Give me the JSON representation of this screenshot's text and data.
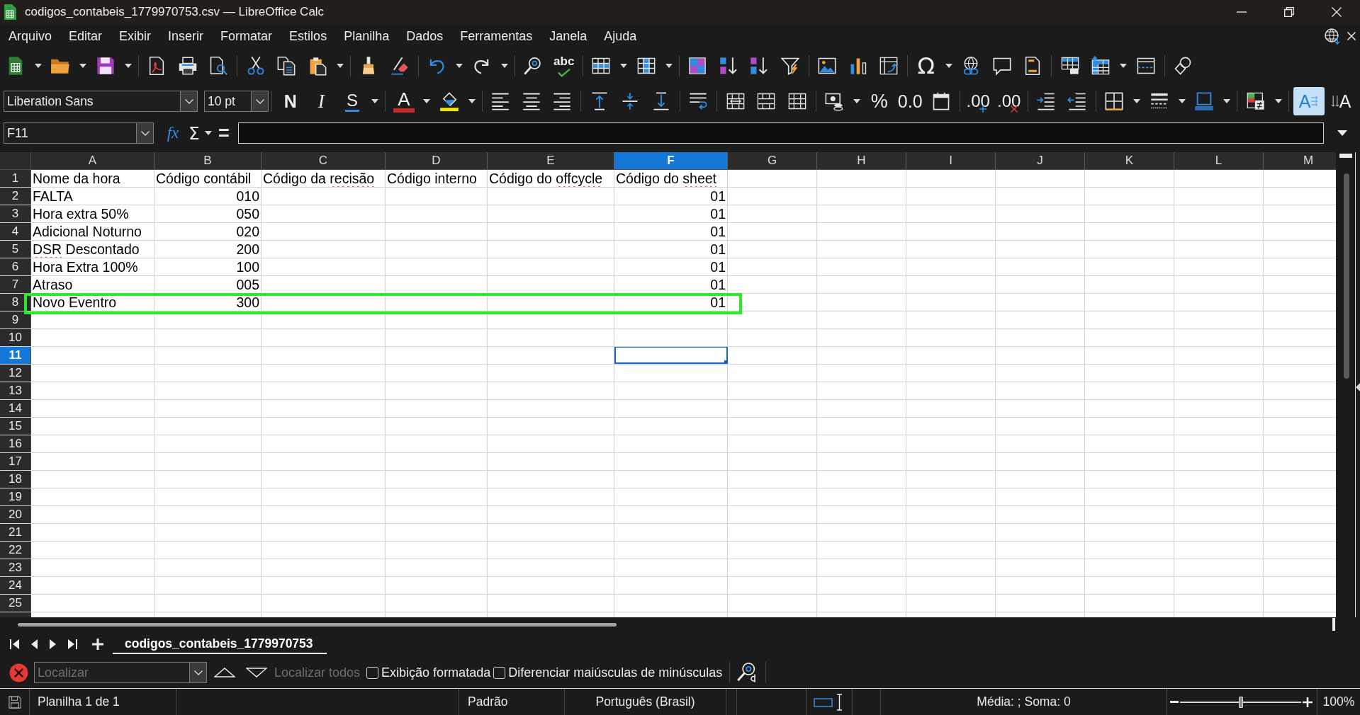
{
  "window": {
    "title": "codigos_contabeis_1779970753.csv — LibreOffice Calc"
  },
  "menu": [
    "Arquivo",
    "Editar",
    "Exibir",
    "Inserir",
    "Formatar",
    "Estilos",
    "Planilha",
    "Dados",
    "Ferramentas",
    "Janela",
    "Ajuda"
  ],
  "standard_toolbar": {
    "spelling": "abc",
    "special_character": "Ω"
  },
  "format_toolbar": {
    "font_name": "Liberation Sans",
    "font_size": "10 pt",
    "bold": "N",
    "italic": "I",
    "underline": "S",
    "font_color": "A",
    "percent": "%",
    "number_format": "0.0",
    "add_decimal": ".00",
    "delete_decimal": ".00",
    "text_direction": [
      {
        "kind": "horizontal",
        "glyph": "A",
        "selected": true
      },
      {
        "kind": "vertical",
        "glyph": "A",
        "selected": false
      }
    ]
  },
  "formula_bar": {
    "cell_reference": "F11",
    "function_wizard": "fx",
    "sum": "Σ",
    "formula": "="
  },
  "sheet": {
    "columns": [
      {
        "label": "A",
        "selected": false
      },
      {
        "label": "B",
        "selected": false
      },
      {
        "label": "C",
        "selected": false
      },
      {
        "label": "D",
        "selected": false
      },
      {
        "label": "E",
        "selected": false
      },
      {
        "label": "F",
        "selected": true
      },
      {
        "label": "G",
        "selected": false
      },
      {
        "label": "H",
        "selected": false
      },
      {
        "label": "I",
        "selected": false
      },
      {
        "label": "J",
        "selected": false
      },
      {
        "label": "K",
        "selected": false
      },
      {
        "label": "L",
        "selected": false
      },
      {
        "label": "M",
        "selected": false
      }
    ],
    "rows": [
      {
        "number": "1",
        "selected": false,
        "highlighted": false,
        "cells": [
          {
            "kind": "text",
            "parts": [
              {
                "text": "Nome da hora",
                "misspelled": false
              }
            ]
          },
          {
            "kind": "text",
            "parts": [
              {
                "text": "Código contábil",
                "misspelled": false
              }
            ]
          },
          {
            "kind": "text",
            "parts": [
              {
                "text": "Código da ",
                "misspelled": false
              },
              {
                "text": "recisão",
                "misspelled": true
              }
            ]
          },
          {
            "kind": "text",
            "parts": [
              {
                "text": "Código interno",
                "misspelled": false
              }
            ]
          },
          {
            "kind": "text",
            "parts": [
              {
                "text": "Código do ",
                "misspelled": false
              },
              {
                "text": "offcycle",
                "misspelled": true
              }
            ]
          },
          {
            "kind": "text",
            "parts": [
              {
                "text": "Código do ",
                "misspelled": false
              },
              {
                "text": "sheet",
                "misspelled": true
              }
            ]
          }
        ]
      },
      {
        "number": "2",
        "selected": false,
        "highlighted": false,
        "cells": [
          {
            "kind": "text",
            "parts": [
              {
                "text": "FALTA",
                "misspelled": false
              }
            ]
          },
          {
            "kind": "number",
            "parts": [
              {
                "text": "010",
                "misspelled": false
              }
            ]
          },
          null,
          null,
          null,
          {
            "kind": "number",
            "parts": [
              {
                "text": "01",
                "misspelled": false
              }
            ]
          }
        ]
      },
      {
        "number": "3",
        "selected": false,
        "highlighted": false,
        "cells": [
          {
            "kind": "text",
            "parts": [
              {
                "text": "Hora extra 50%",
                "misspelled": false
              }
            ]
          },
          {
            "kind": "number",
            "parts": [
              {
                "text": "050",
                "misspelled": false
              }
            ]
          },
          null,
          null,
          null,
          {
            "kind": "number",
            "parts": [
              {
                "text": "01",
                "misspelled": false
              }
            ]
          }
        ]
      },
      {
        "number": "4",
        "selected": false,
        "highlighted": false,
        "cells": [
          {
            "kind": "text",
            "parts": [
              {
                "text": "Adicional Noturno",
                "misspelled": false
              }
            ]
          },
          {
            "kind": "number",
            "parts": [
              {
                "text": "020",
                "misspelled": false
              }
            ]
          },
          null,
          null,
          null,
          {
            "kind": "number",
            "parts": [
              {
                "text": "01",
                "misspelled": false
              }
            ]
          }
        ]
      },
      {
        "number": "5",
        "selected": false,
        "highlighted": false,
        "cells": [
          {
            "kind": "text",
            "parts": [
              {
                "text": "DSR",
                "misspelled": true
              },
              {
                "text": " Descontado",
                "misspelled": false
              }
            ]
          },
          {
            "kind": "number",
            "parts": [
              {
                "text": "200",
                "misspelled": false
              }
            ]
          },
          null,
          null,
          null,
          {
            "kind": "number",
            "parts": [
              {
                "text": "01",
                "misspelled": false
              }
            ]
          }
        ]
      },
      {
        "number": "6",
        "selected": false,
        "highlighted": false,
        "cells": [
          {
            "kind": "text",
            "parts": [
              {
                "text": "Hora Extra 100%",
                "misspelled": false
              }
            ]
          },
          {
            "kind": "number",
            "parts": [
              {
                "text": "100",
                "misspelled": false
              }
            ]
          },
          null,
          null,
          null,
          {
            "kind": "number",
            "parts": [
              {
                "text": "01",
                "misspelled": false
              }
            ]
          }
        ]
      },
      {
        "number": "7",
        "selected": false,
        "highlighted": false,
        "cells": [
          {
            "kind": "text",
            "parts": [
              {
                "text": "Atraso",
                "misspelled": false
              }
            ]
          },
          {
            "kind": "number",
            "parts": [
              {
                "text": "005",
                "misspelled": false
              }
            ]
          },
          null,
          null,
          null,
          {
            "kind": "number",
            "parts": [
              {
                "text": "01",
                "misspelled": false
              }
            ]
          }
        ]
      },
      {
        "number": "8",
        "selected": false,
        "highlighted": true,
        "cells": [
          {
            "kind": "text",
            "parts": [
              {
                "text": "Novo Eventro",
                "misspelled": false
              }
            ]
          },
          {
            "kind": "number",
            "parts": [
              {
                "text": "300",
                "misspelled": false
              }
            ]
          },
          null,
          null,
          null,
          {
            "kind": "number",
            "parts": [
              {
                "text": "01",
                "misspelled": false
              }
            ]
          }
        ]
      },
      {
        "number": "9",
        "selected": false,
        "highlighted": false
      },
      {
        "number": "10",
        "selected": false,
        "highlighted": false
      },
      {
        "number": "11",
        "selected": true,
        "highlighted": false
      },
      {
        "number": "12",
        "selected": false,
        "highlighted": false
      },
      {
        "number": "13",
        "selected": false,
        "highlighted": false
      },
      {
        "number": "14",
        "selected": false,
        "highlighted": false
      },
      {
        "number": "15",
        "selected": false,
        "highlighted": false
      },
      {
        "number": "16",
        "selected": false,
        "highlighted": false
      },
      {
        "number": "17",
        "selected": false,
        "highlighted": false
      },
      {
        "number": "18",
        "selected": false,
        "highlighted": false
      },
      {
        "number": "19",
        "selected": false,
        "highlighted": false
      },
      {
        "number": "20",
        "selected": false,
        "highlighted": false
      },
      {
        "number": "21",
        "selected": false,
        "highlighted": false
      },
      {
        "number": "22",
        "selected": false,
        "highlighted": false
      },
      {
        "number": "23",
        "selected": false,
        "highlighted": false
      },
      {
        "number": "24",
        "selected": false,
        "highlighted": false
      },
      {
        "number": "25",
        "selected": false,
        "highlighted": false
      }
    ]
  },
  "sheet_tabs": [
    {
      "label": "codigos_contabeis_1779970753",
      "selected": true
    }
  ],
  "find_bar": {
    "placeholder": "Localizar",
    "find_all": {
      "label": "Localizar todos",
      "disabled": true
    },
    "options": [
      {
        "label": "Exibição formatada",
        "checked": false
      },
      {
        "label": "Diferenciar maiúsculas de minúsculas",
        "checked": false
      }
    ]
  },
  "status_bar": {
    "sheet_position": "Planilha 1 de 1",
    "page_style": "Padrão",
    "language": "Português (Brasil)",
    "selection_summary": "Média: ; Soma: 0",
    "zoom": {
      "level": 0.5,
      "reading": "100%"
    }
  }
}
